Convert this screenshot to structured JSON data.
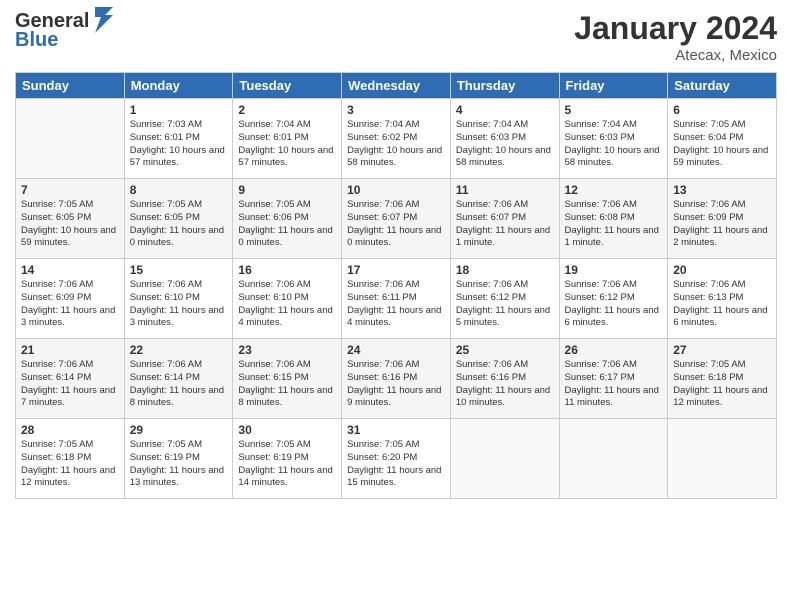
{
  "logo": {
    "line1": "General",
    "line2": "Blue"
  },
  "title": "January 2024",
  "subtitle": "Atecax, Mexico",
  "headers": [
    "Sunday",
    "Monday",
    "Tuesday",
    "Wednesday",
    "Thursday",
    "Friday",
    "Saturday"
  ],
  "weeks": [
    [
      {
        "day": "",
        "sunrise": "",
        "sunset": "",
        "daylight": ""
      },
      {
        "day": "1",
        "sunrise": "Sunrise: 7:03 AM",
        "sunset": "Sunset: 6:01 PM",
        "daylight": "Daylight: 10 hours and 57 minutes."
      },
      {
        "day": "2",
        "sunrise": "Sunrise: 7:04 AM",
        "sunset": "Sunset: 6:01 PM",
        "daylight": "Daylight: 10 hours and 57 minutes."
      },
      {
        "day": "3",
        "sunrise": "Sunrise: 7:04 AM",
        "sunset": "Sunset: 6:02 PM",
        "daylight": "Daylight: 10 hours and 58 minutes."
      },
      {
        "day": "4",
        "sunrise": "Sunrise: 7:04 AM",
        "sunset": "Sunset: 6:03 PM",
        "daylight": "Daylight: 10 hours and 58 minutes."
      },
      {
        "day": "5",
        "sunrise": "Sunrise: 7:04 AM",
        "sunset": "Sunset: 6:03 PM",
        "daylight": "Daylight: 10 hours and 58 minutes."
      },
      {
        "day": "6",
        "sunrise": "Sunrise: 7:05 AM",
        "sunset": "Sunset: 6:04 PM",
        "daylight": "Daylight: 10 hours and 59 minutes."
      }
    ],
    [
      {
        "day": "7",
        "sunrise": "Sunrise: 7:05 AM",
        "sunset": "Sunset: 6:05 PM",
        "daylight": "Daylight: 10 hours and 59 minutes."
      },
      {
        "day": "8",
        "sunrise": "Sunrise: 7:05 AM",
        "sunset": "Sunset: 6:05 PM",
        "daylight": "Daylight: 11 hours and 0 minutes."
      },
      {
        "day": "9",
        "sunrise": "Sunrise: 7:05 AM",
        "sunset": "Sunset: 6:06 PM",
        "daylight": "Daylight: 11 hours and 0 minutes."
      },
      {
        "day": "10",
        "sunrise": "Sunrise: 7:06 AM",
        "sunset": "Sunset: 6:07 PM",
        "daylight": "Daylight: 11 hours and 0 minutes."
      },
      {
        "day": "11",
        "sunrise": "Sunrise: 7:06 AM",
        "sunset": "Sunset: 6:07 PM",
        "daylight": "Daylight: 11 hours and 1 minute."
      },
      {
        "day": "12",
        "sunrise": "Sunrise: 7:06 AM",
        "sunset": "Sunset: 6:08 PM",
        "daylight": "Daylight: 11 hours and 1 minute."
      },
      {
        "day": "13",
        "sunrise": "Sunrise: 7:06 AM",
        "sunset": "Sunset: 6:09 PM",
        "daylight": "Daylight: 11 hours and 2 minutes."
      }
    ],
    [
      {
        "day": "14",
        "sunrise": "Sunrise: 7:06 AM",
        "sunset": "Sunset: 6:09 PM",
        "daylight": "Daylight: 11 hours and 3 minutes."
      },
      {
        "day": "15",
        "sunrise": "Sunrise: 7:06 AM",
        "sunset": "Sunset: 6:10 PM",
        "daylight": "Daylight: 11 hours and 3 minutes."
      },
      {
        "day": "16",
        "sunrise": "Sunrise: 7:06 AM",
        "sunset": "Sunset: 6:10 PM",
        "daylight": "Daylight: 11 hours and 4 minutes."
      },
      {
        "day": "17",
        "sunrise": "Sunrise: 7:06 AM",
        "sunset": "Sunset: 6:11 PM",
        "daylight": "Daylight: 11 hours and 4 minutes."
      },
      {
        "day": "18",
        "sunrise": "Sunrise: 7:06 AM",
        "sunset": "Sunset: 6:12 PM",
        "daylight": "Daylight: 11 hours and 5 minutes."
      },
      {
        "day": "19",
        "sunrise": "Sunrise: 7:06 AM",
        "sunset": "Sunset: 6:12 PM",
        "daylight": "Daylight: 11 hours and 6 minutes."
      },
      {
        "day": "20",
        "sunrise": "Sunrise: 7:06 AM",
        "sunset": "Sunset: 6:13 PM",
        "daylight": "Daylight: 11 hours and 6 minutes."
      }
    ],
    [
      {
        "day": "21",
        "sunrise": "Sunrise: 7:06 AM",
        "sunset": "Sunset: 6:14 PM",
        "daylight": "Daylight: 11 hours and 7 minutes."
      },
      {
        "day": "22",
        "sunrise": "Sunrise: 7:06 AM",
        "sunset": "Sunset: 6:14 PM",
        "daylight": "Daylight: 11 hours and 8 minutes."
      },
      {
        "day": "23",
        "sunrise": "Sunrise: 7:06 AM",
        "sunset": "Sunset: 6:15 PM",
        "daylight": "Daylight: 11 hours and 8 minutes."
      },
      {
        "day": "24",
        "sunrise": "Sunrise: 7:06 AM",
        "sunset": "Sunset: 6:16 PM",
        "daylight": "Daylight: 11 hours and 9 minutes."
      },
      {
        "day": "25",
        "sunrise": "Sunrise: 7:06 AM",
        "sunset": "Sunset: 6:16 PM",
        "daylight": "Daylight: 11 hours and 10 minutes."
      },
      {
        "day": "26",
        "sunrise": "Sunrise: 7:06 AM",
        "sunset": "Sunset: 6:17 PM",
        "daylight": "Daylight: 11 hours and 11 minutes."
      },
      {
        "day": "27",
        "sunrise": "Sunrise: 7:05 AM",
        "sunset": "Sunset: 6:18 PM",
        "daylight": "Daylight: 11 hours and 12 minutes."
      }
    ],
    [
      {
        "day": "28",
        "sunrise": "Sunrise: 7:05 AM",
        "sunset": "Sunset: 6:18 PM",
        "daylight": "Daylight: 11 hours and 12 minutes."
      },
      {
        "day": "29",
        "sunrise": "Sunrise: 7:05 AM",
        "sunset": "Sunset: 6:19 PM",
        "daylight": "Daylight: 11 hours and 13 minutes."
      },
      {
        "day": "30",
        "sunrise": "Sunrise: 7:05 AM",
        "sunset": "Sunset: 6:19 PM",
        "daylight": "Daylight: 11 hours and 14 minutes."
      },
      {
        "day": "31",
        "sunrise": "Sunrise: 7:05 AM",
        "sunset": "Sunset: 6:20 PM",
        "daylight": "Daylight: 11 hours and 15 minutes."
      },
      {
        "day": "",
        "sunrise": "",
        "sunset": "",
        "daylight": ""
      },
      {
        "day": "",
        "sunrise": "",
        "sunset": "",
        "daylight": ""
      },
      {
        "day": "",
        "sunrise": "",
        "sunset": "",
        "daylight": ""
      }
    ]
  ]
}
